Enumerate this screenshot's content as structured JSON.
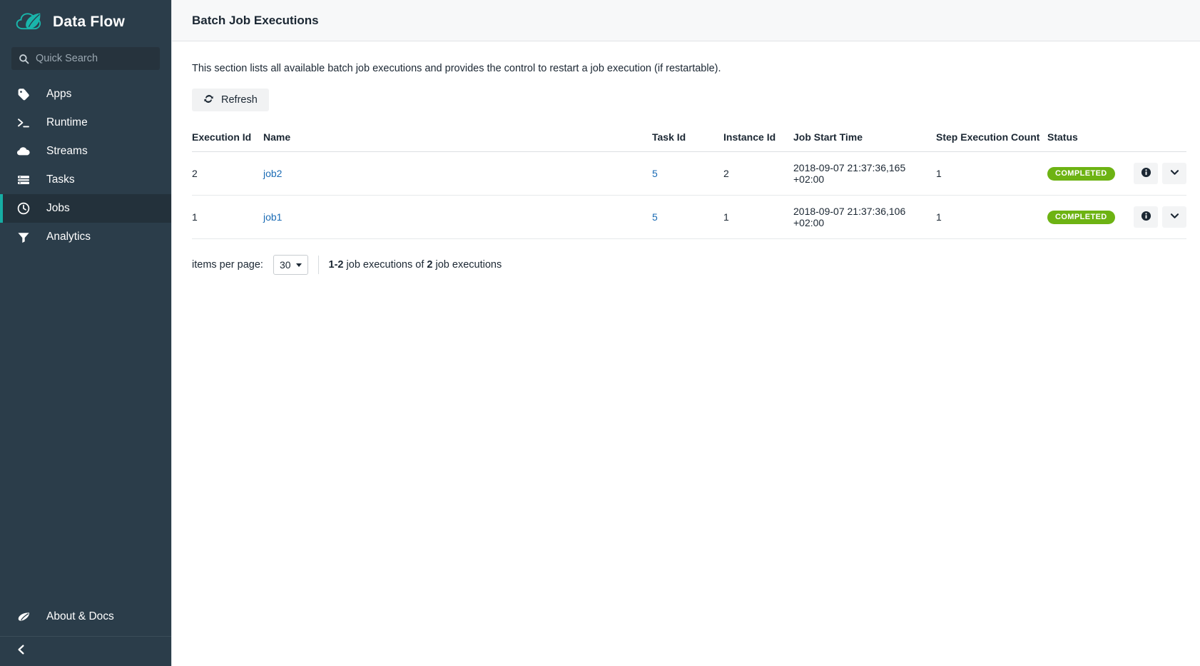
{
  "sidebar": {
    "brand": {
      "title": "Data Flow",
      "logo_icon": "spring-leaf-cloud-logo"
    },
    "search": {
      "placeholder": "Quick Search",
      "value": "",
      "icon": "search-icon"
    },
    "items": [
      {
        "label": "Apps",
        "icon": "tag-icon",
        "active": false
      },
      {
        "label": "Runtime",
        "icon": "terminal-prompt-icon",
        "active": false
      },
      {
        "label": "Streams",
        "icon": "cloud-icon",
        "active": false
      },
      {
        "label": "Tasks",
        "icon": "server-stack-icon",
        "active": false
      },
      {
        "label": "Jobs",
        "icon": "clock-icon",
        "active": true
      },
      {
        "label": "Analytics",
        "icon": "funnel-icon",
        "active": false
      }
    ],
    "about": {
      "label": "About & Docs",
      "icon": "leaf-icon"
    },
    "collapse": {
      "icon": "chevron-left-icon"
    },
    "accent_color": "#16ada4",
    "background_color": "#2b3d4a",
    "active_background_color": "#23313b"
  },
  "header": {
    "title": "Batch Job Executions"
  },
  "main": {
    "description": "This section lists all available batch job executions and provides the control to restart a job execution (if restartable).",
    "refresh_label": "Refresh",
    "refresh_icon": "refresh-icon"
  },
  "table": {
    "columns": [
      "Execution Id",
      "Name",
      "Task Id",
      "Instance Id",
      "Job Start Time",
      "Step Execution Count",
      "Status"
    ],
    "rows": [
      {
        "execution_id": "2",
        "name": "job2",
        "task_id": "5",
        "instance_id": "2",
        "job_start_time": "2018-09-07 21:37:36,165 +02:00",
        "step_execution_count": "1",
        "status": "COMPLETED",
        "actions": {
          "info_icon": "info-circle-icon",
          "expand_icon": "chevron-down-icon"
        }
      },
      {
        "execution_id": "1",
        "name": "job1",
        "task_id": "5",
        "instance_id": "1",
        "job_start_time": "2018-09-07 21:37:36,106 +02:00",
        "step_execution_count": "1",
        "status": "COMPLETED",
        "actions": {
          "info_icon": "info-circle-icon",
          "expand_icon": "chevron-down-icon"
        }
      }
    ],
    "status_color": "#6db313",
    "link_color": "#1a6bb5"
  },
  "pagination": {
    "items_per_page_label": "items per page:",
    "items_per_page_value": "30",
    "summary_range": "1-2",
    "summary_mid": " job executions of ",
    "summary_total": "2",
    "summary_tail": " job executions"
  }
}
